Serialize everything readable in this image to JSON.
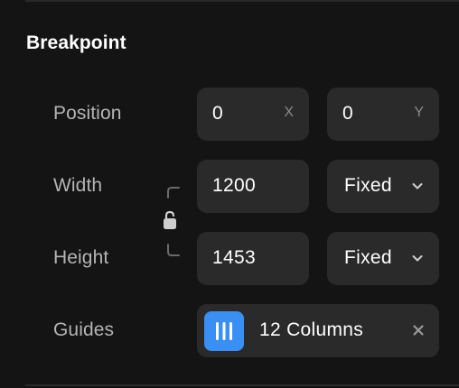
{
  "section": {
    "title": "Breakpoint"
  },
  "position": {
    "label": "Position",
    "x_value": "0",
    "x_axis": "X",
    "y_value": "0",
    "y_axis": "Y"
  },
  "width": {
    "label": "Width",
    "value": "1200",
    "mode": "Fixed"
  },
  "height": {
    "label": "Height",
    "value": "1453",
    "mode": "Fixed"
  },
  "guides": {
    "label": "Guides",
    "value": "12 Columns"
  },
  "icons": {
    "link": "unlink-icon",
    "chevron": "chevron-down-icon",
    "grid": "columns-grid-icon",
    "close": "close-icon"
  },
  "colors": {
    "background": "#141414",
    "field": "#2a2a2a",
    "accent": "#3a8ff5",
    "label": "#b4b4b4",
    "text": "#ffffff"
  }
}
